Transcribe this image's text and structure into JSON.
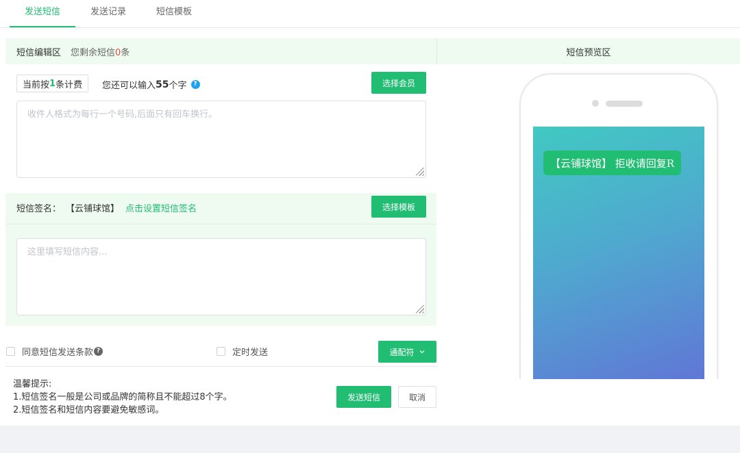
{
  "tabs": [
    {
      "label": "发送短信",
      "active": true
    },
    {
      "label": "发送记录",
      "active": false
    },
    {
      "label": "短信模板",
      "active": false
    }
  ],
  "editor": {
    "title": "短信编辑区",
    "remain_prefix": "您剩余短信",
    "remain_count": "0",
    "remain_suffix": "条",
    "fee_prefix": "当前按",
    "fee_count": "1",
    "fee_suffix": "条计费",
    "can_input_prefix": "您还可以输入",
    "can_input_count": "55",
    "can_input_suffix": "个字",
    "help_glyph": "?",
    "select_member_button": "选择会员",
    "recipients_placeholder": "收件人格式为每行一个号码,后面只有回车换行。"
  },
  "signature": {
    "label": "短信签名：",
    "name": "【云铺球馆】",
    "set_link": "点击设置短信签名",
    "select_template_button": "选择模板",
    "content_placeholder": "这里填写短信内容..."
  },
  "options": {
    "agree_label": "同意短信发送条款",
    "agree_help": "?",
    "schedule_label": "定时发送",
    "wildcard_button": "通配符"
  },
  "tips": {
    "title": "温馨提示:",
    "line1": "1.短信签名一般是公司或品牌的简称且不能超过8个字。",
    "line2": "2.短信签名和短信内容要避免敏感词。"
  },
  "actions": {
    "send_button": "发送短信",
    "cancel_button": "取消"
  },
  "preview": {
    "title": "短信预览区",
    "message": "【云铺球馆】 拒收请回复R"
  },
  "colors": {
    "accent": "#21bd73",
    "panel_bg": "#effbf1",
    "remain_count": "#e84c3d",
    "help_icon": "#1ea1f2"
  }
}
